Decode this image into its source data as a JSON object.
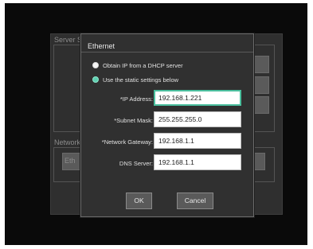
{
  "background": {
    "server_label": "Server S",
    "network_label": "Network",
    "network_button_text": "Eth"
  },
  "dialog": {
    "title": "Ethernet",
    "options": [
      {
        "label": "Obtain IP from a DHCP server",
        "checked": false
      },
      {
        "label": "Use the static settings below",
        "checked": true
      }
    ],
    "fields": {
      "ip_address": {
        "label": "*IP Address:",
        "value": "192.168.1.221"
      },
      "subnet_mask": {
        "label": "*Subnet Mask:",
        "value": "255.255.255.0"
      },
      "gateway": {
        "label": "*Network Gateway:",
        "value": "192.168.1.1"
      },
      "dns": {
        "label": "DNS Server:",
        "value": "192.168.1.1"
      }
    },
    "ok_label": "OK",
    "cancel_label": "Cancel"
  },
  "colors": {
    "accent": "#4bbf9e",
    "dialog_bg": "#303030",
    "screen_bg": "#0a0a0a"
  }
}
